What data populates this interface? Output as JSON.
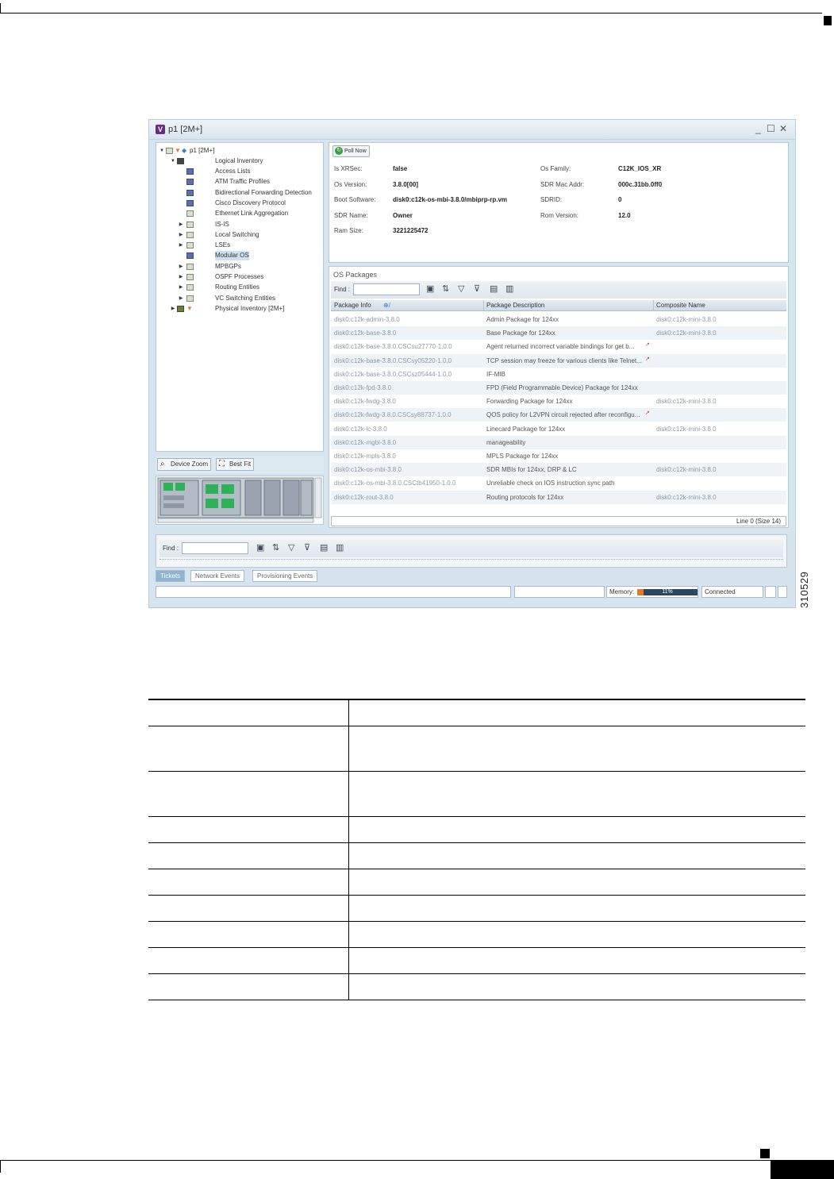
{
  "window": {
    "title": "p1 [2M+]",
    "logo": "V",
    "controls": [
      "_",
      "☐",
      "✕"
    ]
  },
  "tree": {
    "root": "p1 [2M+]",
    "logical": "Logical Inventory",
    "items": [
      "Access Lists",
      "ATM Traffic Profiles",
      "Bidirectional Forwarding Detection",
      "Cisco Discovery Protocol",
      "Ethernet Link Aggregation",
      "IS-IS",
      "Local Switching",
      "LSEs",
      "Modular OS",
      "MPBGPs",
      "OSPF Processes",
      "Routing Entities",
      "VC Switching Entities"
    ],
    "physical": "Physical Inventory [2M+]",
    "selected_index": 8
  },
  "zoom": {
    "device_zoom": "Device Zoom",
    "best_fit": "Best Fit"
  },
  "info": {
    "poll_now": "Poll Now",
    "left": [
      {
        "k": "Is XRSec:",
        "v": "false"
      },
      {
        "k": "Os Version:",
        "v": "3.8.0[00]"
      },
      {
        "k": "Boot Software:",
        "v": "disk0:c12k-os-mbi-3.8.0/mbiprp-rp.vm"
      },
      {
        "k": "SDR Name:",
        "v": "Owner"
      },
      {
        "k": "Ram Size:",
        "v": "3221225472"
      }
    ],
    "right": [
      {
        "k": "Os Family:",
        "v": "C12K_IOS_XR"
      },
      {
        "k": "SDR Mac Addr:",
        "v": "000c.31bb.0ff0"
      },
      {
        "k": "SDRID:",
        "v": "0"
      },
      {
        "k": "Rom Version:",
        "v": "12.0"
      }
    ]
  },
  "packages": {
    "title": "OS Packages",
    "find_label": "Find :",
    "columns": [
      "Package Info",
      "Package Description",
      "Composite Name"
    ],
    "rows": [
      [
        "disk0:c12k-admin-3.8.0",
        "Admin Package for 124xx",
        "disk0:c12k-mini-3.8.0"
      ],
      [
        "disk0:c12k-base-3.8.0",
        "Base Package for 124xx",
        "disk0:c12k-mini-3.8.0"
      ],
      [
        "disk0:c12k-base-3.8.0.CSCsu27770-1.0.0",
        "Agent returned incorrect variable bindings for get b...",
        ""
      ],
      [
        "disk0:c12k-base-3.8.0.CSCsy05220-1.0.0",
        "TCP session may freeze for various clients like Telnet...",
        ""
      ],
      [
        "disk0:c12k-base-3.8.0.CSCsz05444-1.0.0",
        "IF-MIB",
        ""
      ],
      [
        "disk0:c12k-fpd-3.8.0",
        "FPD (Field Programmable Device) Package for 124xx",
        ""
      ],
      [
        "disk0:c12k-fwdg-3.8.0",
        "Forwarding Package for 124xx",
        "disk0:c12k-mini-3.8.0"
      ],
      [
        "disk0:c12k-fwdg-3.8.0.CSCsy88737-1.0.0",
        "QOS policy for L2VPN circuit rejected after reconfigu...",
        ""
      ],
      [
        "disk0:c12k-lc-3.8.0",
        "Linecard Package for 124xx",
        "disk0:c12k-mini-3.8.0"
      ],
      [
        "disk0:c12k-mgbl-3.8.0",
        "manageability",
        ""
      ],
      [
        "disk0:c12k-mpls-3.8.0",
        "MPLS Package for 124xx",
        ""
      ],
      [
        "disk0:c12k-os-mbi-3.8.0",
        "SDR MBIs for 124xx, DRP & LC",
        "disk0:c12k-mini-3.8.0"
      ],
      [
        "disk0:c12k-os-mbi-3.8.0.CSCtb41950-1.0.0",
        "Unreliable check on IOS instruction sync path",
        ""
      ],
      [
        "disk0:c12k-rout-3.8.0",
        "Routing protocols for 124xx",
        "disk0:c12k-mini-3.8.0"
      ]
    ],
    "status": "Line 0 (Size 14)"
  },
  "bottom": {
    "find_label": "Find :",
    "tabs": [
      "Tickets",
      "Network Events",
      "Provisioning Events"
    ],
    "active_tab": 0
  },
  "statusbar": {
    "memory_label": "Memory:",
    "memory_pct": 11,
    "memory_text": "11%",
    "connection": "Connected"
  },
  "figure_number": "310529",
  "colors": {
    "accent": "#8fb3d0",
    "window_bg": "#d5e4ee",
    "memory_fill": "#e07b2a"
  }
}
